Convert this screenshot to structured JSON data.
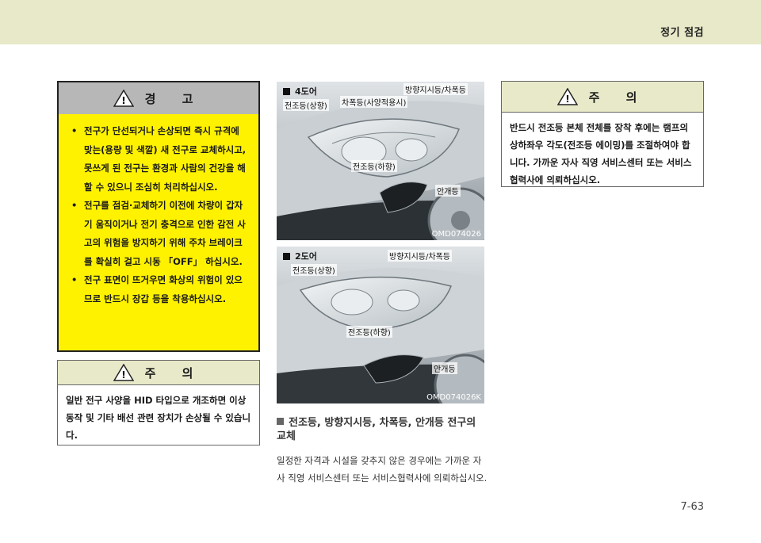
{
  "header": {
    "title": "정기 점검"
  },
  "warning": {
    "title": "경 고",
    "items": [
      "전구가 단선되거나 손상되면 즉시 규격에 맞는(용량 및 색깔) 새 전구로 교체하시고, 못쓰게 된 전구는 환경과 사람의 건강을 해 할 수 있으니 조심히 처리하십시오.",
      "전구를 점검·교체하기 이전에 차량이 갑자기 움직이거나 전기 충격으로 인한 감전 사고의 위험을 방지하기 위해 주차 브레이크를 확실히 걸고 시동 「OFF」 하십시오.",
      "전구 표면이 뜨거우면 화상의 위험이 있으므로 반드시 장갑 등을 착용하십시오."
    ]
  },
  "caution_left": {
    "title": "주 의",
    "text": "일반 전구 사양을 HID 타입으로 개조하면 이상 동작 및 기타 배선 관련 장치가 손상될 수 있습니다."
  },
  "photo1": {
    "tag": "4도어",
    "labels": {
      "headlamp_high": "전조등(상향)",
      "position": "차폭등(사양적용시)",
      "turn": "방향지시등/차폭등",
      "headlamp_low": "전조등(하향)",
      "fog": "안개등"
    },
    "code": "OMD074026"
  },
  "photo2": {
    "tag": "2도어",
    "labels": {
      "headlamp_high": "전조등(상향)",
      "turn": "방향지시등/차폭등",
      "headlamp_low": "전조등(하향)",
      "fog": "안개등"
    },
    "code": "OMD074026K"
  },
  "section": {
    "title": "전조등, 방향지시등, 차폭등, 안개등 전구의 교체",
    "body": "일정한 자격과 시설을 갖추지 않은 경우에는 가까운 자사 직영 서비스센터 또는 서비스협력사에 의뢰하십시오."
  },
  "caution_right": {
    "title": "주 의",
    "text": "반드시 전조등 본체 전체를 장착 후에는 램프의 상하좌우 각도(전조등 에이밍)를 조절하여야 합니다. 가까운 자사 직영 서비스센터 또는 서비스협력사에 의뢰하십시오."
  },
  "page": {
    "number": "7-63"
  },
  "colors": {
    "header_bg": "#e8e9c8",
    "warning_bg": "#fff200",
    "warning_head": "#b7b7b7"
  }
}
